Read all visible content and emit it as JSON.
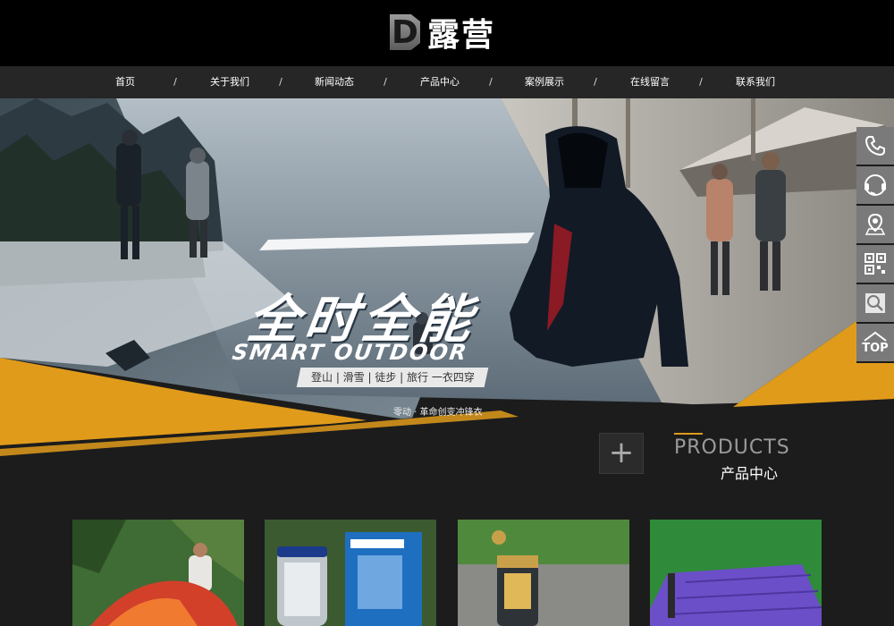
{
  "logo": {
    "mark": "D",
    "text": "露营"
  },
  "nav": {
    "items": [
      {
        "label": "首页"
      },
      {
        "label": "关于我们"
      },
      {
        "label": "新闻动态"
      },
      {
        "label": "产品中心"
      },
      {
        "label": "案例展示"
      },
      {
        "label": "在线留言"
      },
      {
        "label": "联系我们"
      }
    ],
    "separator": "/"
  },
  "banner": {
    "headline": "全时全能",
    "subhead": "SMART OUTDOOR",
    "tagline": "登山 | 滑雪 | 徒步 | 旅行 一衣四穿",
    "caption": "零动 · 革命创变冲锋衣"
  },
  "products": {
    "title_en": "PRODUCTS",
    "title_cn": "产品中心",
    "plus_symbol": "+"
  },
  "side_toolbar": {
    "top_label": "TOP"
  },
  "colors": {
    "accent": "#e09b1b",
    "nav_bg": "#262626",
    "header_bg": "#000000"
  }
}
